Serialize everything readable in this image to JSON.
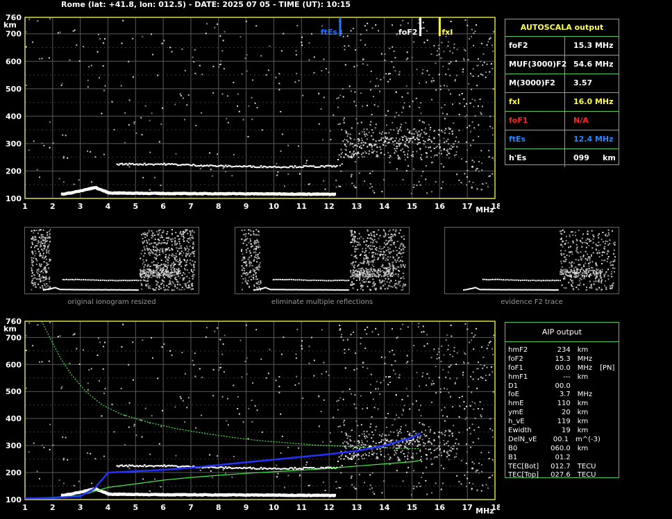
{
  "header": {
    "title": "Rome (lat: +41.8, lon: 012.5) - DATE: 2025 07 05 - TIME (UT): 10:15"
  },
  "top_chart": {
    "y_unit": "km",
    "x_unit": "MHz",
    "markers": [
      {
        "label": "ftEs",
        "freq": 12.4,
        "color": "#2277ff"
      },
      {
        "label": "foF2",
        "freq": 15.3,
        "color": "#ffffff"
      },
      {
        "label": "fxI",
        "freq": 16.0,
        "color": "#ffff44"
      }
    ]
  },
  "chart_data": [
    {
      "type": "scatter",
      "x": {
        "range": [
          1,
          18
        ],
        "ticks": [
          1,
          2,
          3,
          4,
          5,
          6,
          7,
          8,
          9,
          10,
          11,
          12,
          13,
          14,
          15,
          16,
          17,
          18
        ]
      },
      "y": {
        "range": [
          100,
          760
        ],
        "ticks": [
          100,
          200,
          300,
          400,
          500,
          600,
          700,
          760
        ]
      },
      "grid": true,
      "series": [
        {
          "trace": "E-layer",
          "points": [
            [
              2.3,
              115
            ],
            [
              2.6,
              120
            ],
            [
              3.0,
              128
            ],
            [
              3.5,
              140
            ],
            [
              4.0,
              120
            ],
            [
              6.0,
              118
            ],
            [
              9.0,
              117
            ],
            [
              12.2,
              115
            ]
          ]
        },
        {
          "trace": "Es-layer",
          "points": [
            [
              4.3,
              225
            ],
            [
              6.0,
              225
            ],
            [
              8.0,
              218
            ],
            [
              10.0,
              215
            ],
            [
              12.3,
              217
            ]
          ]
        },
        {
          "trace": "F2-layer",
          "points": [
            [
              12.3,
              230
            ],
            [
              12.8,
              260
            ],
            [
              13.5,
              300
            ],
            [
              14.5,
              305
            ],
            [
              15.3,
              320
            ]
          ]
        }
      ]
    },
    {
      "type": "line",
      "x": {
        "range": [
          1,
          18
        ],
        "ticks": [
          1,
          2,
          3,
          4,
          5,
          6,
          7,
          8,
          9,
          10,
          11,
          12,
          13,
          14,
          15,
          16,
          17,
          18
        ]
      },
      "y": {
        "range": [
          100,
          760
        ],
        "ticks": [
          100,
          200,
          300,
          400,
          500,
          600,
          700,
          760
        ]
      },
      "grid": true,
      "series": [
        {
          "color": "#44ee44",
          "x": [
            1.6,
            1.8,
            2.0,
            2.3,
            2.7,
            3.2,
            3.8,
            4.5,
            5.5,
            6.5,
            7.5,
            8.5,
            9.5,
            10.5,
            11.5,
            12.5,
            13.5,
            14.5,
            15.3
          ],
          "y": [
            760,
            720,
            680,
            620,
            560,
            500,
            450,
            415,
            385,
            362,
            345,
            330,
            318,
            310,
            302,
            297,
            293,
            290,
            288
          ]
        },
        {
          "color": "#44ee44",
          "x": [
            1.0,
            2.0,
            3.0,
            3.5,
            4.0,
            5.0,
            6.0,
            7.0,
            8.0,
            9.0,
            10.0,
            11.0,
            12.0,
            13.0,
            14.0,
            15.0,
            15.3
          ],
          "y": [
            105,
            108,
            115,
            130,
            145,
            158,
            172,
            182,
            190,
            197,
            203,
            209,
            215,
            224,
            232,
            240,
            245
          ]
        },
        {
          "color": "#2233ff",
          "x": [
            1.0,
            2.0,
            3.0,
            3.5,
            3.8,
            4.0,
            5.0,
            6.0,
            7.0,
            8.0,
            9.0,
            10.0,
            11.0,
            12.0,
            13.0,
            14.0,
            15.0,
            15.3
          ],
          "y": [
            105,
            106,
            112,
            140,
            175,
            200,
            205,
            210,
            218,
            228,
            238,
            248,
            258,
            268,
            280,
            300,
            330,
            345
          ]
        }
      ]
    }
  ],
  "thumbnails": [
    {
      "caption": "original ionogram resized"
    },
    {
      "caption": "eliminate multiple reflections"
    },
    {
      "caption": "evidence F2 trace"
    }
  ],
  "autoscala": {
    "title": "AUTOSCALA output",
    "rows": [
      {
        "name": "foF2",
        "value": "15.3 MHz",
        "color": "#ffffff"
      },
      {
        "name": "MUF(3000)F2",
        "value": "54.6 MHz",
        "color": "#ffffff"
      },
      {
        "name": "M(3000)F2",
        "value": "3.57",
        "color": "#ffffff"
      },
      {
        "name": "fxI",
        "value": "16.0 MHz",
        "color": "#ffff44"
      },
      {
        "name": "foF1",
        "value": "N/A",
        "color": "#ff2222"
      },
      {
        "name": "ftEs",
        "value": "12.4 MHz",
        "color": "#2288ff"
      },
      {
        "name": "h'Es",
        "value": "099     km",
        "color": "#ffffff"
      }
    ]
  },
  "aip": {
    "title": "AIP output",
    "rows": [
      {
        "name": "hmF2",
        "value": "234",
        "unit": "km",
        "extra": ""
      },
      {
        "name": "foF2",
        "value": "15.3",
        "unit": "MHz",
        "extra": ""
      },
      {
        "name": "foF1",
        "value": "00.0",
        "unit": "MHz",
        "extra": "[PN]"
      },
      {
        "name": "hmF1",
        "value": "---",
        "unit": "km",
        "extra": ""
      },
      {
        "name": "D1",
        "value": "00.0",
        "unit": "",
        "extra": ""
      },
      {
        "name": "foE",
        "value": "3.7",
        "unit": "MHz",
        "extra": ""
      },
      {
        "name": "hmE",
        "value": "110",
        "unit": "km",
        "extra": ""
      },
      {
        "name": "ymE",
        "value": "20",
        "unit": "km",
        "extra": ""
      },
      {
        "name": "h_vE",
        "value": "119",
        "unit": "km",
        "extra": ""
      },
      {
        "name": "Ewidth",
        "value": "19",
        "unit": "km",
        "extra": ""
      },
      {
        "name": "DelN_vE",
        "value": "00.1",
        "unit": "m^(-3)",
        "extra": ""
      },
      {
        "name": "B0",
        "value": "060.0",
        "unit": "km",
        "extra": ""
      },
      {
        "name": "B1",
        "value": "01.2",
        "unit": "",
        "extra": ""
      },
      {
        "name": "TEC[Bot]",
        "value": "012.7",
        "unit": "TECU",
        "extra": ""
      },
      {
        "name": "TEC[Top]",
        "value": "027.6",
        "unit": "TECU",
        "extra": ""
      }
    ]
  }
}
